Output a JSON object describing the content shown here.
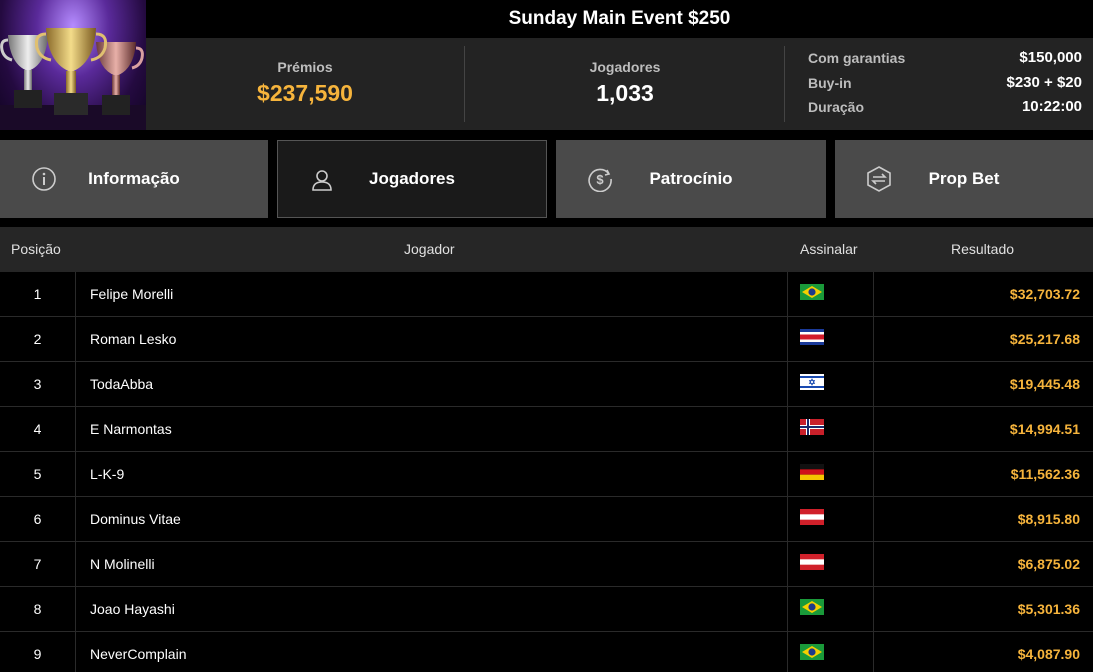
{
  "tournament": {
    "title": "Sunday Main Event $250",
    "prize_label": "Prémios",
    "prize_value": "$237,590",
    "players_label": "Jogadores",
    "players_value": "1,033",
    "details": [
      {
        "key": "Com garantias",
        "value": "$150,000"
      },
      {
        "key": "Buy-in",
        "value": "$230 + $20"
      },
      {
        "key": "Duração",
        "value": "10:22:00"
      }
    ]
  },
  "tabs": [
    {
      "label": "Informação",
      "icon": "info-icon",
      "active": false
    },
    {
      "label": "Jogadores",
      "icon": "user-icon",
      "active": true
    },
    {
      "label": "Patrocínio",
      "icon": "dollar-icon",
      "active": false
    },
    {
      "label": "Prop Bet",
      "icon": "prop-bet-icon",
      "active": false
    }
  ],
  "table": {
    "headers": {
      "position": "Posição",
      "player": "Jogador",
      "flag": "Assinalar",
      "result": "Resultado"
    },
    "rows": [
      {
        "pos": "1",
        "name": "Felipe Morelli",
        "flag": "brazil",
        "result": "$32,703.72"
      },
      {
        "pos": "2",
        "name": "Roman Lesko",
        "flag": "costa-rica",
        "result": "$25,217.68"
      },
      {
        "pos": "3",
        "name": "TodaAbba",
        "flag": "israel",
        "result": "$19,445.48"
      },
      {
        "pos": "4",
        "name": "E Narmontas",
        "flag": "norway",
        "result": "$14,994.51"
      },
      {
        "pos": "5",
        "name": "L-K-9",
        "flag": "germany",
        "result": "$11,562.36"
      },
      {
        "pos": "6",
        "name": "Dominus Vitae",
        "flag": "austria",
        "result": "$8,915.80"
      },
      {
        "pos": "7",
        "name": "N Molinelli",
        "flag": "austria",
        "result": "$6,875.02"
      },
      {
        "pos": "8",
        "name": "Joao Hayashi",
        "flag": "brazil",
        "result": "$5,301.36"
      },
      {
        "pos": "9",
        "name": "NeverComplain",
        "flag": "brazil",
        "result": "$4,087.90"
      }
    ]
  },
  "colors": {
    "accent": "#f6b43c",
    "tab_bg": "#4a4a4a",
    "tab_active_bg": "#1a1a1a"
  }
}
